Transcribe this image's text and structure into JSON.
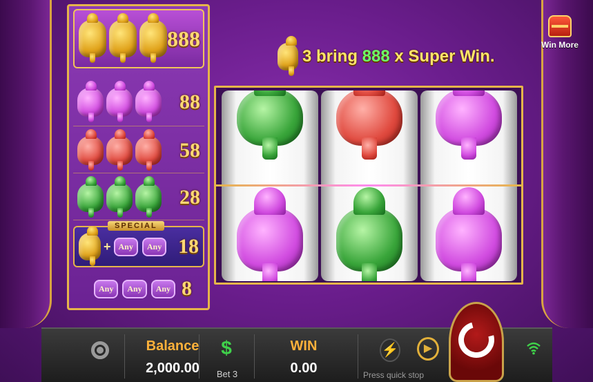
{
  "paytable": {
    "rows": [
      {
        "symbol": "gold-ganesha",
        "count": 3,
        "payout": "888"
      },
      {
        "symbol": "pink-ganesha",
        "count": 3,
        "payout": "88"
      },
      {
        "symbol": "red-ganesha",
        "count": 3,
        "payout": "58"
      },
      {
        "symbol": "green-ganesha",
        "count": 3,
        "payout": "28"
      }
    ],
    "special": {
      "tag": "SPECIAL",
      "plus": "+",
      "any1": "Any",
      "any2": "Any",
      "payout": "18"
    },
    "any_row": {
      "any1": "Any",
      "any2": "Any",
      "any3": "Any",
      "payout": "8"
    }
  },
  "banner": {
    "prefix": "3 bring ",
    "highlight": "888",
    "suffix": " x Super Win."
  },
  "win_more": {
    "label": "Win More",
    "icon": "treasure-chest-icon"
  },
  "reels": {
    "top_row": [
      "green-ganesha",
      "red-ganesha",
      "pink-ganesha"
    ],
    "bottom_row": [
      "pink-ganesha",
      "green-ganesha",
      "pink-ganesha"
    ]
  },
  "bottom": {
    "settings_icon": "gear-icon",
    "balance_label": "Balance",
    "balance_value": "2,000.00",
    "bet_icon": "$",
    "bet_label": "Bet 3",
    "win_label": "WIN",
    "win_value": "0.00",
    "quick_stop_label": "Press quick stop",
    "turbo_icon": "⚡",
    "auto_icon": "▶",
    "signal_icon": "wifi-icon"
  },
  "colors": {
    "gold": "#e6b54a",
    "purple": "#6a1d8c",
    "accent_orange": "#ffb13a",
    "accent_green": "#3fd14a"
  }
}
